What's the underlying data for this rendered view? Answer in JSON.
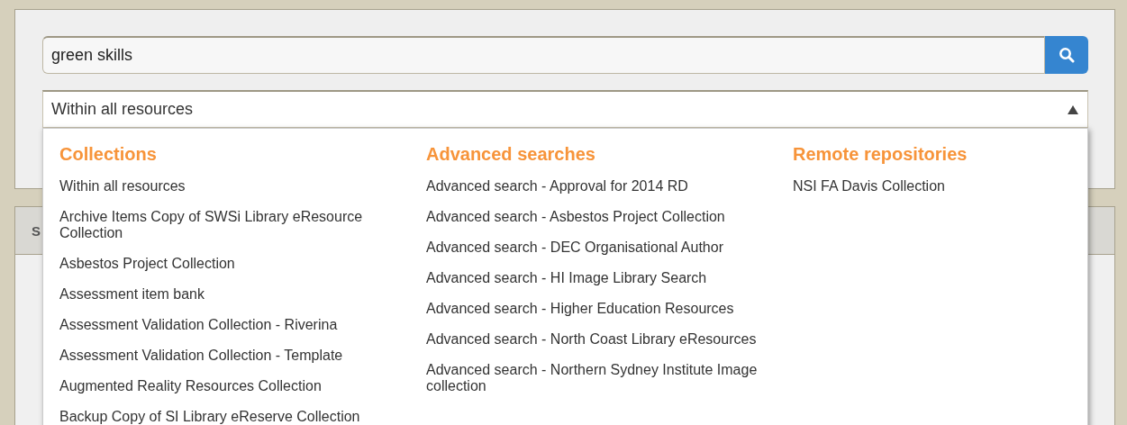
{
  "search": {
    "value": "green skills"
  },
  "scope_select": {
    "value": "Within all resources",
    "expanded": true
  },
  "lower_panel": {
    "heading": "S"
  },
  "dropdown": {
    "groups": [
      {
        "heading": "Collections",
        "items": [
          "Within all resources",
          "Archive Items Copy of SWSi Library eResource Collection",
          "Asbestos Project Collection",
          "Assessment item bank",
          "Assessment Validation Collection - Riverina",
          "Assessment Validation Collection - Template",
          "Augmented Reality Resources Collection",
          "Backup Copy of SI Library eReserve Collection"
        ]
      },
      {
        "heading": "Advanced searches",
        "items": [
          "Advanced search - Approval for 2014 RD",
          "Advanced search - Asbestos Project Collection",
          "Advanced search - DEC Organisational Author",
          "Advanced search - HI Image Library Search",
          "Advanced search - Higher Education Resources",
          "Advanced search - North Coast Library eResources",
          "Advanced search - Northern Sydney Institute Image collection"
        ]
      },
      {
        "heading": "Remote repositories",
        "items": [
          "NSI FA Davis Collection"
        ]
      }
    ]
  }
}
